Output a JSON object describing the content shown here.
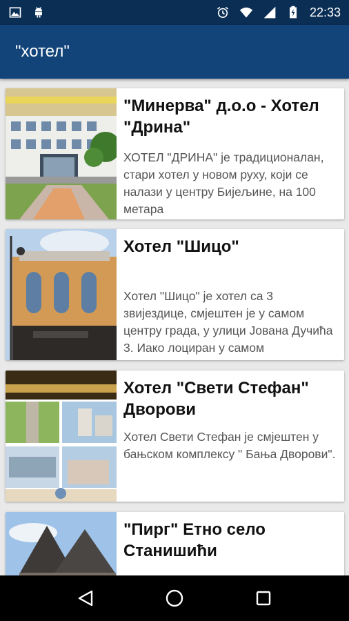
{
  "status_bar": {
    "time": "22:33",
    "icons": [
      "image-icon",
      "android-icon",
      "alarm-icon",
      "wifi-icon",
      "signal-icon",
      "battery-charging-icon"
    ]
  },
  "app_bar": {
    "title": "\"хотел\""
  },
  "results": [
    {
      "title": "\"Минерва\" д.о.о - Хотел \"Дрина\"",
      "description": "ХОТЕЛ \"ДРИНА\" је традиционалан, стари хотел у новом руху, који се налази у центру Бијељине, на 100 метара",
      "image": "hotel-drina-photo"
    },
    {
      "title": "Хотел \"Шицо\"",
      "description": "Хотел \"Шицо\" је хотел са 3 звијездице, смјештен је у самом центру града, у улици Јована Дучића 3. Иако лоциран у самом",
      "image": "hotel-sico-photo"
    },
    {
      "title": "Хотел \"Свети Стефан\" Дворови",
      "description": "Хотел Свети Стефан је смјештен у бањском комплексу \" Бања Дворови\".",
      "image": "hotel-sveti-stefan-collage"
    },
    {
      "title": "\"Пирг\" Етно село Станишићи",
      "description": "",
      "image": "pirg-etno-selo-photo"
    }
  ],
  "colors": {
    "status_bar": "#0b2e55",
    "app_bar": "#12447a",
    "background": "#e9e9e9",
    "nav_bar": "#000000"
  }
}
